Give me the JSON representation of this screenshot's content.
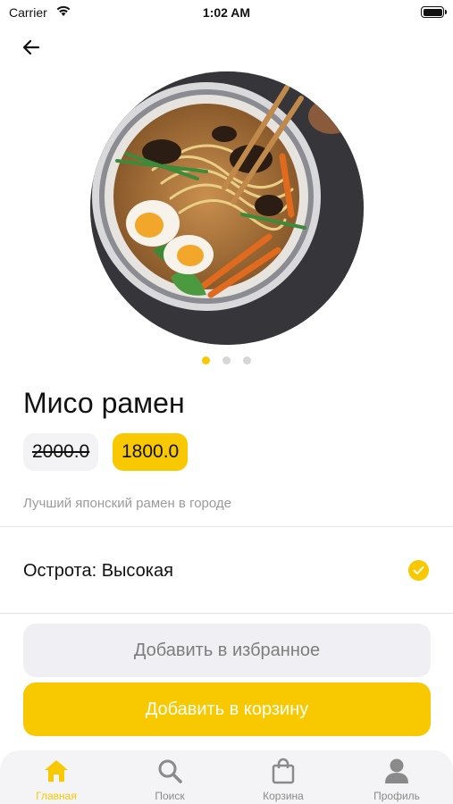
{
  "status_bar": {
    "carrier": "Carrier",
    "time": "1:02 AM"
  },
  "product": {
    "name": "Мисо рамен",
    "old_price": "2000.0",
    "new_price": "1800.0",
    "description": "Лучший японский рамен в городе",
    "image": "ramen-bowl-photo"
  },
  "carousel": {
    "pages": 3,
    "active": 0
  },
  "option": {
    "label": "Острота: Высокая",
    "selected": true
  },
  "actions": {
    "favorite_label": "Добавить в избранное",
    "cart_label": "Добавить в корзину"
  },
  "tabs": [
    {
      "label": "Главная",
      "icon": "home-icon",
      "active": true
    },
    {
      "label": "Поиск",
      "icon": "search-icon",
      "active": false
    },
    {
      "label": "Корзина",
      "icon": "bag-icon",
      "active": false
    },
    {
      "label": "Профиль",
      "icon": "profile-icon",
      "active": false
    }
  ],
  "colors": {
    "accent": "#f8c800",
    "muted_bg": "#f0f0f4",
    "tab_bg": "#f4f4f6"
  }
}
